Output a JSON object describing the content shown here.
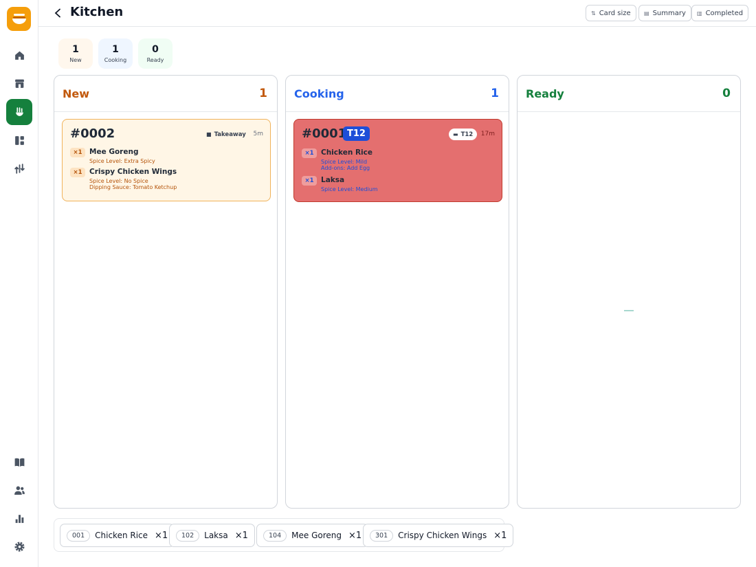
{
  "app": {
    "title": "Kitchen",
    "header_buttons": [
      {
        "label": "Card size",
        "icon": "sort-icon"
      },
      {
        "label": "Summary",
        "icon": "document-icon"
      },
      {
        "label": "Completed",
        "icon": "clipboard-icon"
      }
    ]
  },
  "sidebar": {
    "top_items": [
      "home-icon",
      "store-icon",
      "chef-icon",
      "layout-icon",
      "flow-icon"
    ],
    "bottom_items": [
      "book-icon",
      "users-icon",
      "chart-icon",
      "settings-icon"
    ]
  },
  "stats": [
    {
      "value": "1",
      "label": "New"
    },
    {
      "value": "1",
      "label": "Cooking"
    },
    {
      "value": "0",
      "label": "Ready"
    }
  ],
  "columns": {
    "new": {
      "title": "New",
      "count": "1",
      "color": "#c2590c",
      "card": {
        "order": "#0002",
        "tag": "Takeaway",
        "age": "5m",
        "items": [
          {
            "qty": "×1",
            "name": "Mee Goreng",
            "mods": [
              "Spice Level: Extra Spicy"
            ]
          },
          {
            "qty": "×1",
            "name": "Crispy Chicken Wings",
            "mods": [
              "Spice Level: No Spice",
              "Dipping Sauce: Tomato Ketchup"
            ]
          }
        ]
      }
    },
    "cooking": {
      "title": "Cooking",
      "count": "1",
      "color": "#2563eb",
      "card": {
        "order": "#0001",
        "table": "T12",
        "tag": "T12",
        "age": "17m",
        "items": [
          {
            "qty": "×1",
            "name": "Chicken Rice",
            "mods": [
              "Spice Level: Mild",
              "Add-ons: Add Egg"
            ]
          },
          {
            "qty": "×1",
            "name": "Laksa",
            "mods": [
              "Spice Level: Medium"
            ]
          }
        ]
      }
    },
    "ready": {
      "title": "Ready",
      "count": "0",
      "color": "#15803d"
    }
  },
  "summary": [
    {
      "code": "001",
      "name": "Chicken Rice",
      "qty": "×1"
    },
    {
      "code": "102",
      "name": "Laksa",
      "qty": "×1"
    },
    {
      "code": "104",
      "name": "Mee Goreng",
      "qty": "×1"
    },
    {
      "code": "301",
      "name": "Crispy Chicken Wings",
      "qty": "×1"
    }
  ]
}
